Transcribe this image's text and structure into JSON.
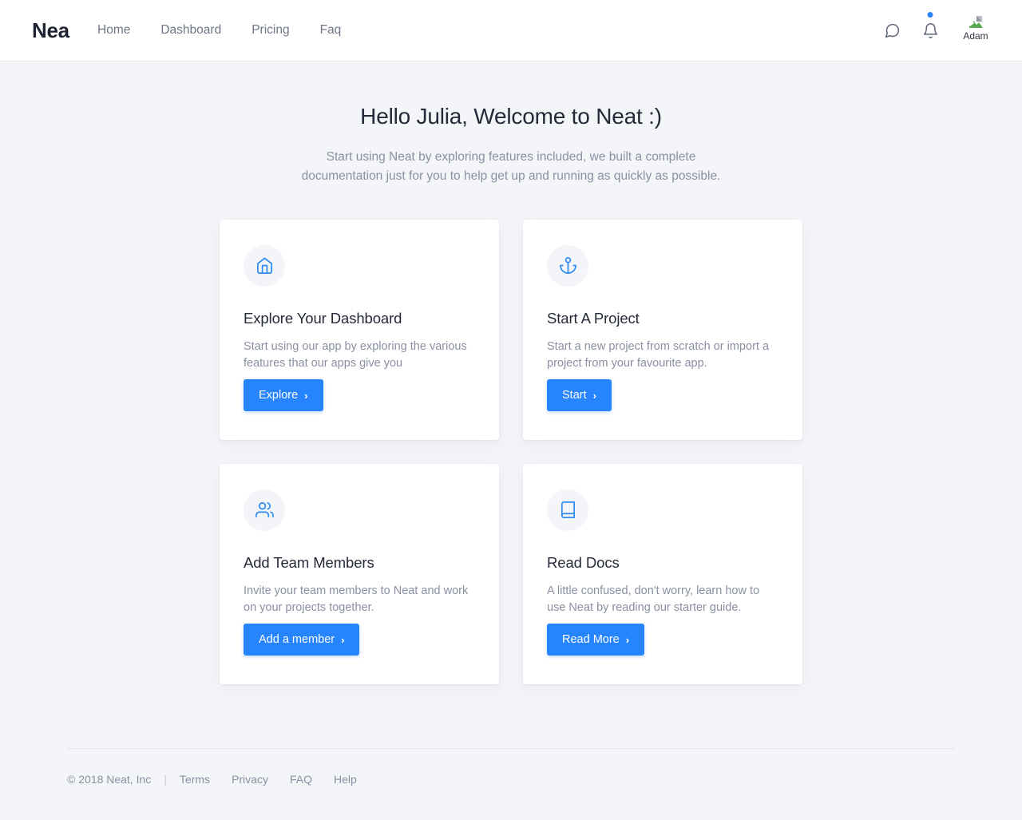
{
  "header": {
    "logo": "Nea",
    "nav": [
      {
        "label": "Home"
      },
      {
        "label": "Dashboard"
      },
      {
        "label": "Pricing"
      },
      {
        "label": "Faq"
      }
    ],
    "chat_icon": "chat-bubble-icon",
    "bell_icon": "bell-icon",
    "has_notification": true,
    "avatar_alt": "Adam",
    "accent_color": "#2684ff"
  },
  "hero": {
    "title": "Hello Julia, Welcome to Neat :)",
    "subtitle": "Start using Neat by exploring features included, we built a complete documentation just for you to help get up and running as quickly as possible."
  },
  "cards": [
    {
      "icon": "home-icon",
      "title": "Explore Your Dashboard",
      "description": "Start using our app by exploring the various features that our apps give you",
      "button": "Explore",
      "button_chevron": "›"
    },
    {
      "icon": "anchor-icon",
      "title": "Start A Project",
      "description": "Start a new project from scratch or import a project from your favourite app.",
      "button": "Start",
      "button_chevron": "›"
    },
    {
      "icon": "users-icon",
      "title": "Add Team Members",
      "description": "Invite your team members to Neat and work on your projects together.",
      "button": "Add a member",
      "button_chevron": "›"
    },
    {
      "icon": "book-icon",
      "title": "Read Docs",
      "description": "A little confused, don't worry, learn how to use Neat by reading our starter guide.",
      "button": "Read More",
      "button_chevron": "›"
    }
  ],
  "footer": {
    "copyright": "© 2018 Neat, Inc",
    "separator": "|",
    "links": [
      {
        "label": "Terms"
      },
      {
        "label": "Privacy"
      },
      {
        "label": "FAQ"
      },
      {
        "label": "Help"
      }
    ]
  }
}
